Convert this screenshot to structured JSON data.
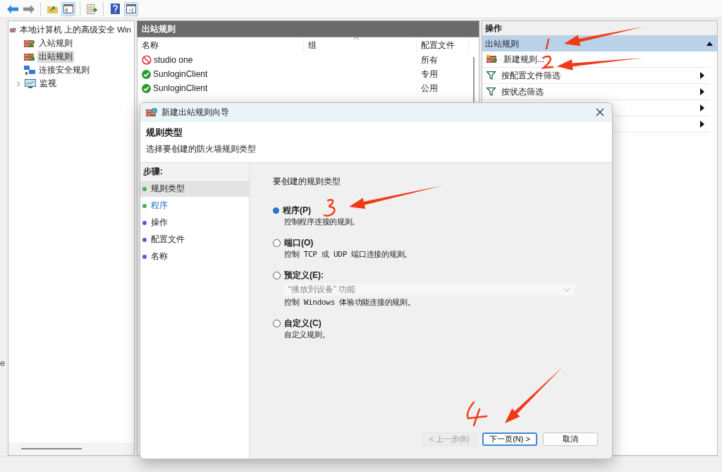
{
  "toolbar": {
    "groups": [
      [
        {
          "kind": "back",
          "pressed": false,
          "disabled": false
        },
        {
          "kind": "forward",
          "pressed": false,
          "disabled": true
        }
      ],
      [
        {
          "kind": "up",
          "pressed": false,
          "disabled": false
        },
        {
          "kind": "tree",
          "pressed": true,
          "disabled": false
        }
      ],
      [
        {
          "kind": "export",
          "pressed": false,
          "disabled": false
        }
      ],
      [
        {
          "kind": "help",
          "pressed": false,
          "disabled": false
        },
        {
          "kind": "action_pane",
          "pressed": true,
          "disabled": false
        }
      ]
    ]
  },
  "edge_text": "e",
  "tree": {
    "root": {
      "label": "本地计算机 上的高级安全 Win",
      "children": [
        {
          "label": "入站规则",
          "kind": "inbound",
          "selected": false
        },
        {
          "label": "出站规则",
          "kind": "outbound",
          "selected": true
        },
        {
          "label": "连接安全规则",
          "kind": "security",
          "selected": false
        },
        {
          "label": "监视",
          "kind": "monitor",
          "selected": false,
          "expanded": false
        }
      ]
    }
  },
  "rules": {
    "title": "出站规则",
    "columns": [
      "名称",
      "组",
      "配置文件"
    ],
    "rows": [
      {
        "name": "studio one",
        "kind": "blocked",
        "profile": "所有"
      },
      {
        "name": "SunloginClient",
        "kind": "allowed",
        "profile": "专用"
      },
      {
        "name": "SunloginClient",
        "kind": "allowed",
        "profile": "公用"
      }
    ]
  },
  "actions": {
    "title": "操作",
    "section": {
      "label": "出站规则",
      "expanded": true
    },
    "items": [
      {
        "label": "新建规则...",
        "kind": "new_rule",
        "submenu": false
      },
      {
        "label": "按配置文件筛选",
        "kind": "filter",
        "submenu": true
      },
      {
        "label": "按状态筛选",
        "kind": "filter",
        "submenu": true
      },
      {
        "kind": "covered",
        "submenu": true
      },
      {
        "kind": "covered",
        "submenu": true
      }
    ]
  },
  "dialog": {
    "title": "新建出站规则向导",
    "heading": "规则类型",
    "subheading": "选择要创建的防火墙规则类型",
    "steps_title": "步骤:",
    "steps": [
      {
        "label": "规则类型",
        "color": "#4caf50",
        "selected": true,
        "link": false
      },
      {
        "label": "程序",
        "color": "#4caf50",
        "selected": false,
        "link": true
      },
      {
        "label": "操作",
        "color": "#5a5acd",
        "selected": false,
        "link": false
      },
      {
        "label": "配置文件",
        "color": "#5a5acd",
        "selected": false,
        "link": false
      },
      {
        "label": "名称",
        "color": "#5a5acd",
        "selected": false,
        "link": false
      }
    ],
    "prompt": "要创建的规则类型",
    "options": [
      {
        "label": "程序(P)",
        "description": "控制程序连接的规则。",
        "selected": true
      },
      {
        "label": "端口(O)",
        "description": "控制 TCP 或 UDP 端口连接的规则。",
        "selected": false
      },
      {
        "label": "预定义(E):",
        "dropdown": {
          "value": "“播放到设备” 功能",
          "disabled": true
        },
        "description": "控制 Windows 体验功能连接的规则。",
        "selected": false
      },
      {
        "label": "自定义(C)",
        "description": "自定义规则。",
        "selected": false
      }
    ],
    "buttons": [
      {
        "label": "< 上一步(B)",
        "disabled": true,
        "default": false
      },
      {
        "label": "下一页(N) >",
        "disabled": false,
        "default": true
      },
      {
        "label": "取消",
        "disabled": false,
        "default": false
      }
    ]
  }
}
